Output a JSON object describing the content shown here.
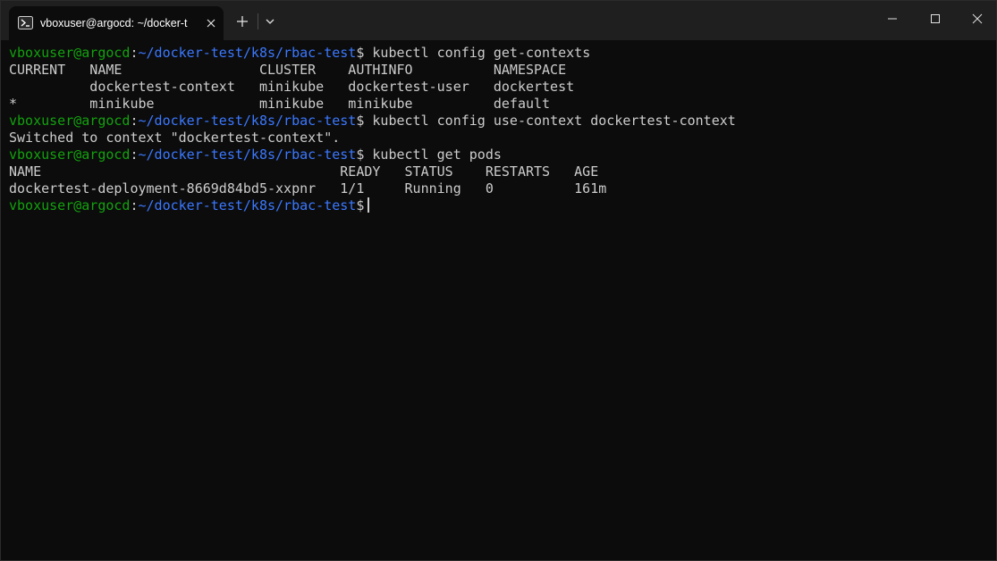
{
  "window": {
    "tab_title": "vboxuser@argocd: ~/docker-t",
    "tab_icon": "powershell-terminal-icon",
    "controls": [
      "minimize-icon",
      "maximize-icon",
      "close-icon"
    ]
  },
  "colors": {
    "background": "#0c0c0c",
    "titlebar": "#1f1f1f",
    "text": "#cccccc",
    "prompt_user": "#13a10e",
    "prompt_path": "#3b78ff"
  },
  "prompt": {
    "user": "vboxuser@argocd",
    "sep": ":",
    "path": "~/docker-test/k8s/rbac-test",
    "dollar": "$"
  },
  "commands": [
    " kubectl config get-contexts",
    " kubectl config use-context dockertest-context",
    " kubectl get pods",
    " "
  ],
  "outputs": {
    "contexts_header": "CURRENT   NAME                 CLUSTER    AUTHINFO          NAMESPACE",
    "contexts_row_1": "          dockertest-context   minikube   dockertest-user   dockertest",
    "contexts_row_2": "*         minikube             minikube   minikube          default",
    "switched": "Switched to context \"dockertest-context\".",
    "pods_header": "NAME                                     READY   STATUS    RESTARTS   AGE",
    "pods_row_1": "dockertest-deployment-8669d84bd5-xxpnr   1/1     Running   0          161m"
  }
}
